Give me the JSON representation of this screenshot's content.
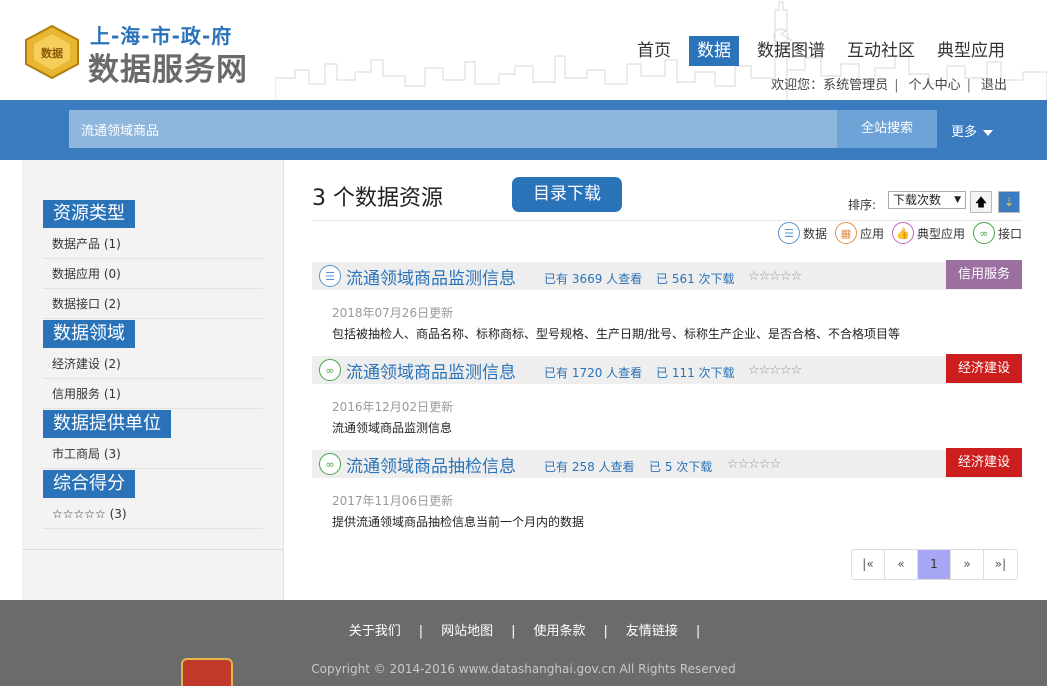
{
  "header": {
    "logo_line1": "上-海-市-政-府",
    "logo_line2": "数据服务网",
    "logo_emblem_text": "数据"
  },
  "nav": [
    {
      "label": "首页"
    },
    {
      "label": "数据"
    },
    {
      "label": "数据图谱"
    },
    {
      "label": "互动社区"
    },
    {
      "label": "典型应用"
    }
  ],
  "userbar": {
    "welcome": "欢迎您：系统管理员",
    "center": "个人中心",
    "logout": "退出"
  },
  "search": {
    "value": "流通领域商品",
    "button": "全站搜索",
    "more": "更多"
  },
  "sidebar": {
    "sections": [
      {
        "title": "资源类型",
        "items": [
          "数据产品 (1)",
          "数据应用 (0)",
          "数据接口 (2)"
        ]
      },
      {
        "title": "数据领域",
        "items": [
          "经济建设 (2)",
          "信用服务 (1)"
        ]
      },
      {
        "title": "数据提供单位",
        "items": [
          "市工商局 (3)"
        ]
      },
      {
        "title": "综合得分",
        "items": [
          "☆☆☆☆☆ (3)"
        ]
      }
    ]
  },
  "main": {
    "count_text": "3 个数据资源",
    "download_btn": "目录下载",
    "sort_label": "排序:",
    "sort_value": "下载次数",
    "legend": [
      {
        "label": "数据"
      },
      {
        "label": "应用"
      },
      {
        "label": "典型应用"
      },
      {
        "label": "接口"
      }
    ],
    "items": [
      {
        "icon": "data-icon",
        "title": "流通领域商品监测信息",
        "views": "已有 3669 人查看",
        "downloads": "已 561 次下载",
        "stars": "☆☆☆☆☆",
        "tag": "信用服务",
        "tag_color": "#9b6fa0",
        "date": "2018年07月26日更新",
        "desc": "包括被抽检人、商品名称、标称商标、型号规格、生产日期/批号、标称生产企业、是否合格、不合格项目等"
      },
      {
        "icon": "api-icon",
        "title": "流通领域商品监测信息",
        "views": "已有 1720 人查看",
        "downloads": "已 111 次下载",
        "stars": "☆☆☆☆☆",
        "tag": "经济建设",
        "tag_color": "#cc1e1e",
        "date": "2016年12月02日更新",
        "desc": "流通领域商品监测信息"
      },
      {
        "icon": "api-icon",
        "title": "流通领域商品抽检信息",
        "views": "已有 258 人查看",
        "downloads": "已 5 次下载",
        "stars": "☆☆☆☆☆",
        "tag": "经济建设",
        "tag_color": "#cc1e1e",
        "date": "2017年11月06日更新",
        "desc": "提供流通领域商品抽检信息当前一个月内的数据"
      }
    ]
  },
  "pager": [
    "|«",
    "«",
    "1",
    "»",
    "»|"
  ],
  "footer": {
    "links": [
      "关于我们",
      "网站地图",
      "使用条款",
      "友情链接"
    ],
    "copyright": "Copyright © 2014-2016 www.datashanghai.gov.cn All Rights Reserved"
  },
  "colors": {
    "brand": "#2a73b9",
    "search_bar": "#3b7bbf",
    "footer": "#6b6b6b"
  }
}
